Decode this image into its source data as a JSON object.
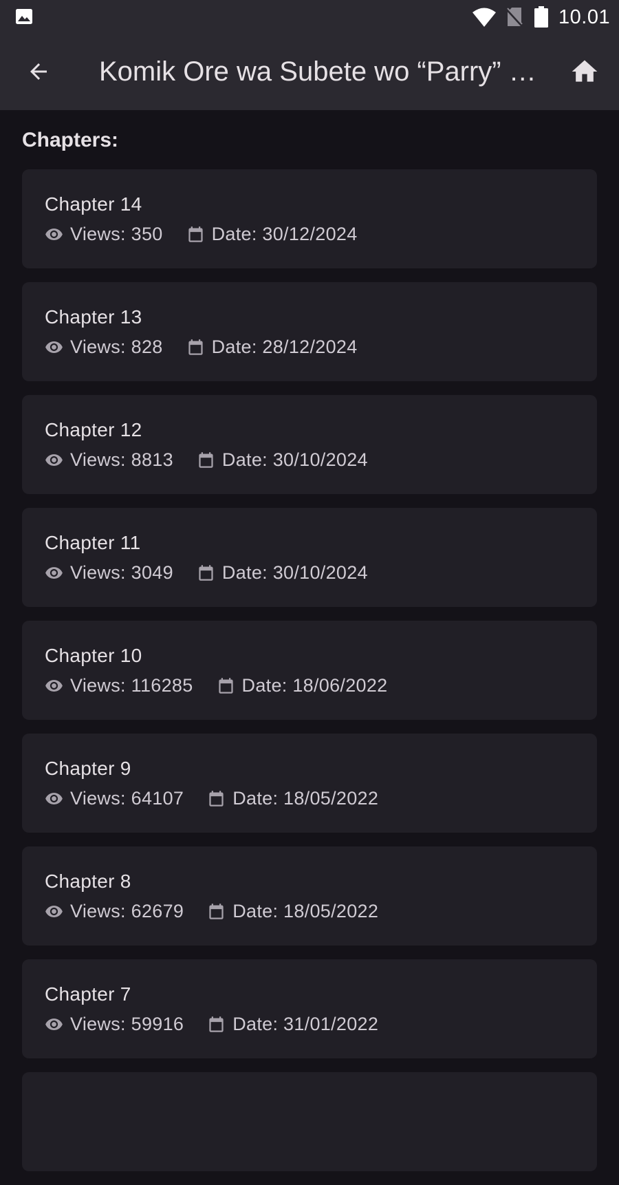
{
  "status_bar": {
    "time": "10.01",
    "icons": [
      "gallery-icon",
      "wifi-icon",
      "no-sim-icon",
      "battery-icon"
    ]
  },
  "app_bar": {
    "title": "Komik Ore wa Subete wo “Parry” suru",
    "back_icon": "arrow-back-icon",
    "home_icon": "home-icon"
  },
  "section": {
    "label": "Chapters:"
  },
  "colors": {
    "background": "#141218",
    "bar": "#2b2930",
    "card": "#211f26",
    "text": "#e6e1e5",
    "muted": "#d0cbd3",
    "icon": "#a7a2ab"
  },
  "chapters": [
    {
      "title": "Chapter 14",
      "views": "Views: 350",
      "date": "Date: 30/12/2024"
    },
    {
      "title": "Chapter 13",
      "views": "Views: 828",
      "date": "Date: 28/12/2024"
    },
    {
      "title": "Chapter 12",
      "views": "Views: 8813",
      "date": "Date: 30/10/2024"
    },
    {
      "title": "Chapter 11",
      "views": "Views: 3049",
      "date": "Date: 30/10/2024"
    },
    {
      "title": "Chapter 10",
      "views": "Views: 116285",
      "date": "Date: 18/06/2022"
    },
    {
      "title": "Chapter 9",
      "views": "Views: 64107",
      "date": "Date: 18/05/2022"
    },
    {
      "title": "Chapter 8",
      "views": "Views: 62679",
      "date": "Date: 18/05/2022"
    },
    {
      "title": "Chapter 7",
      "views": "Views: 59916",
      "date": "Date: 31/01/2022"
    },
    {
      "title": "",
      "views": "",
      "date": ""
    }
  ]
}
